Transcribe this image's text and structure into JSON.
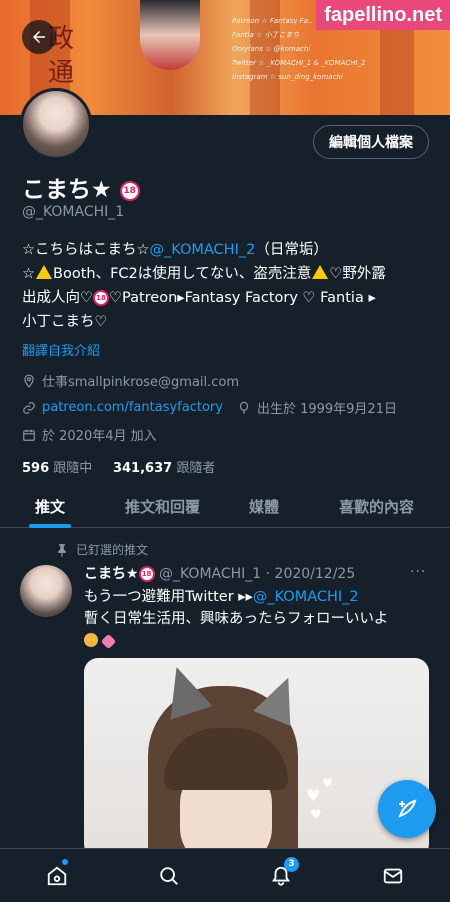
{
  "banner": {
    "kanji": "政\n通",
    "lines": [
      "Patreon ☆ Fantasy Fa...",
      "Fantia ☆ 小丁こまち",
      "Onlyfans ☆ @komachi",
      "Twitter ☆ _KOMACHI_1 & _KOMACHI_2",
      "Instagram ☆ sun_ding_komachi"
    ]
  },
  "watermark": "fapellino.net",
  "profile": {
    "edit_button": "編輯個人檔案",
    "display_name": "こまち★",
    "age_badge": "18",
    "handle": "@_KOMACHI_1",
    "bio": {
      "line1_prefix": "☆こちらはこまち☆",
      "line1_link": "@_KOMACHI_2",
      "line1_suffix": "（日常垢）",
      "line2_a": "☆",
      "line2_b": "Booth、FC2は使用してない、盗売注意",
      "line2_c": "♡野外露",
      "line3_a": "出成人向♡",
      "line3_b": "♡Patreon▸Fantasy Factory ♡ Fantia ▸",
      "line4": "小丁こまち♡"
    },
    "translate": "翻譯自我介紹",
    "email": "仕事smallpinkrose@gmail.com",
    "website": "patreon.com/fantasyfactory",
    "birthday": "出生於 1999年9月21日",
    "joined": "於 2020年4月 加入",
    "following_count": "596",
    "following_label": "跟隨中",
    "followers_count": "341,637",
    "followers_label": "跟隨者"
  },
  "tabs": [
    "推文",
    "推文和回覆",
    "媒體",
    "喜歡的內容"
  ],
  "tweet": {
    "pinned_label": "已釘選的推文",
    "name": "こまち★",
    "handle_date": "@_KOMACHI_1 · 2020/12/25",
    "more": "···",
    "line1_prefix": "もう一つ避難用Twitter ▸▸",
    "line1_link": "@_KOMACHI_2",
    "line2": "暫く日常生活用、興味あったらフォローいいよ"
  },
  "nav": {
    "notifications_count": "3"
  },
  "colors": {
    "background": "#15202b",
    "accent": "#1d9bf0",
    "muted": "#8b98a5",
    "watermark": "#e8497a"
  },
  "icons": [
    "back-arrow-icon",
    "home-icon",
    "search-icon",
    "bell-icon",
    "mail-icon",
    "compose-icon",
    "location-icon",
    "link-icon",
    "balloon-icon",
    "calendar-icon",
    "pin-icon"
  ]
}
